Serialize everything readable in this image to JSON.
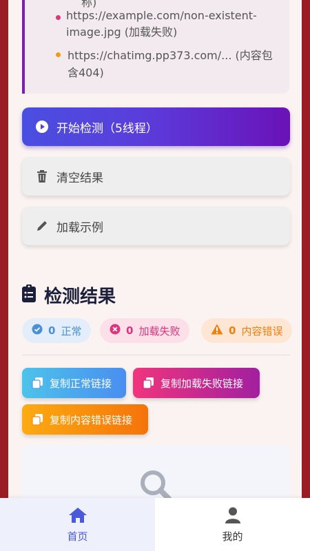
{
  "info_list": {
    "top_fragment": "称)",
    "items": [
      {
        "text_line1": "https://example.com/non-existent-",
        "text_line2": "image.jpg (加载失败)",
        "dot_color": "#e0337a"
      },
      {
        "text_line1": "https://chatimg.pp373.com/... (内容包",
        "text_line2": "含404)",
        "dot_color": "#f59a0b"
      }
    ]
  },
  "actions": {
    "start_label": "开始检测（5线程）",
    "clear_label": "清空结果",
    "example_label": "加载示例"
  },
  "results": {
    "title": "检测结果",
    "stats": [
      {
        "count": "0",
        "label": "正常",
        "color": "#4a90d9",
        "bg": "#e3eefa"
      },
      {
        "count": "0",
        "label": "加载失败",
        "color": "#e0337a",
        "bg": "#fbe0ea"
      },
      {
        "count": "0",
        "label": "内容错误",
        "color": "#f08010",
        "bg": "#fde7d4"
      }
    ],
    "copy_buttons": [
      {
        "label": "复制正常链接"
      },
      {
        "label": "复制加载失败链接"
      },
      {
        "label": "复制内容错误链接"
      }
    ]
  },
  "nav": {
    "items": [
      {
        "label": "首页"
      },
      {
        "label": "我的"
      }
    ]
  }
}
